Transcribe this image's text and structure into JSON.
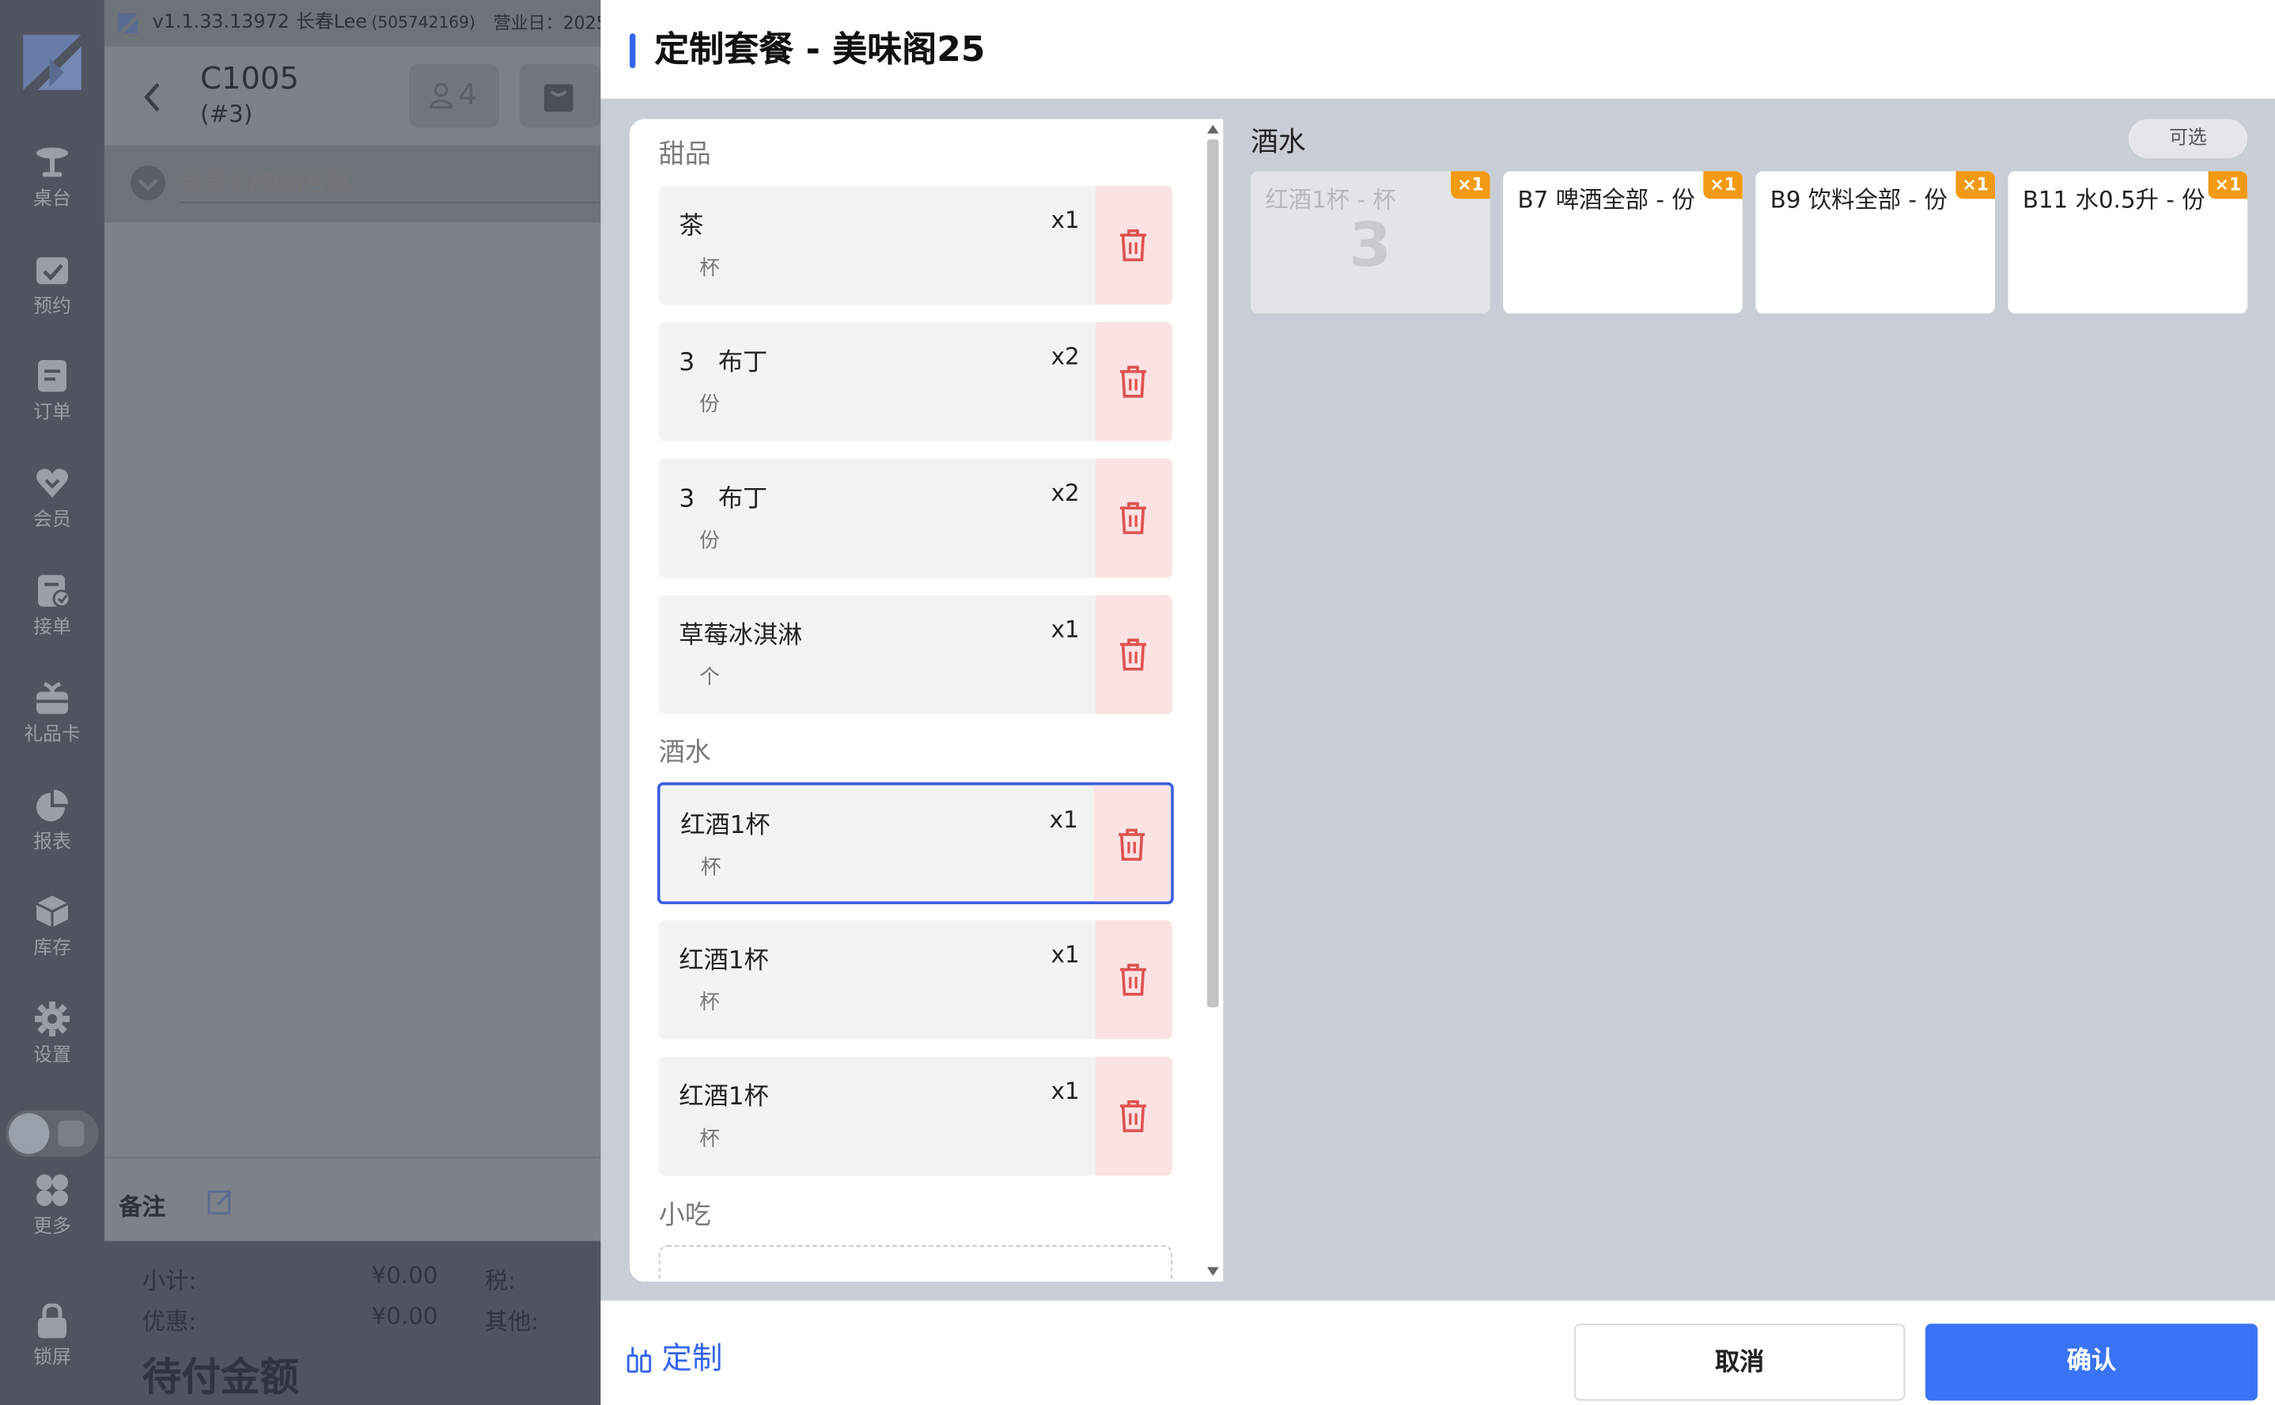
{
  "topbar": {
    "version": "v1.1.33.13972",
    "user": "长春Lee",
    "user_id": "(505742169)",
    "business_day": "营业日：2025"
  },
  "order": {
    "table": "C1005",
    "sub": "(#3)",
    "guests": "4"
  },
  "member": {
    "placeholder": "会员卡/电话号码"
  },
  "sidebar": {
    "items": [
      {
        "label": "桌台",
        "icon": "table-icon"
      },
      {
        "label": "预约",
        "icon": "calendar-check-icon"
      },
      {
        "label": "订单",
        "icon": "order-icon"
      },
      {
        "label": "会员",
        "icon": "heart-icon"
      },
      {
        "label": "接单",
        "icon": "accept-order-icon"
      },
      {
        "label": "礼品卡",
        "icon": "gift-card-icon"
      },
      {
        "label": "报表",
        "icon": "pie-chart-icon"
      },
      {
        "label": "库存",
        "icon": "box-icon"
      },
      {
        "label": "设置",
        "icon": "gear-icon"
      },
      {
        "label": "更多",
        "icon": "grid-icon"
      },
      {
        "label": "锁屏",
        "icon": "lock-icon"
      }
    ]
  },
  "notes": {
    "label": "备注"
  },
  "totals": {
    "subtotal_label": "小计:",
    "subtotal": "¥0.00",
    "tax_label": "税:",
    "discount_label": "优惠:",
    "discount": "¥0.00",
    "other_label": "其他:",
    "due_label": "待付金额"
  },
  "modal": {
    "title": "定制套餐 - 美味阁25",
    "sections": [
      {
        "name": "甜品",
        "items": [
          {
            "name": "茶",
            "unit": "杯",
            "qty": "x1",
            "selected": false
          },
          {
            "name": "3   布丁",
            "unit": "份",
            "qty": "x2",
            "selected": false
          },
          {
            "name": "3   布丁",
            "unit": "份",
            "qty": "x2",
            "selected": false
          },
          {
            "name": "草莓冰淇淋",
            "unit": "个",
            "qty": "x1",
            "selected": false
          }
        ]
      },
      {
        "name": "酒水",
        "items": [
          {
            "name": "红酒1杯",
            "unit": "杯",
            "qty": "x1",
            "selected": true
          },
          {
            "name": "红酒1杯",
            "unit": "杯",
            "qty": "x1",
            "selected": false
          },
          {
            "name": "红酒1杯",
            "unit": "杯",
            "qty": "x1",
            "selected": false
          }
        ]
      },
      {
        "name": "小吃",
        "items": []
      }
    ],
    "options_title": "酒水",
    "optional_label": "可选",
    "options": [
      {
        "name": "红酒1杯 - 杯",
        "badge": "×1",
        "count": "3",
        "disabled": true
      },
      {
        "name": "B7 啤酒全部 - 份",
        "badge": "×1",
        "count": "",
        "disabled": false
      },
      {
        "name": "B9 饮料全部 - 份",
        "badge": "×1",
        "count": "",
        "disabled": false
      },
      {
        "name": "B11 水0.5升 - 份",
        "badge": "×1",
        "count": "",
        "disabled": false
      }
    ],
    "custom_label": "定制",
    "cancel_label": "取消",
    "confirm_label": "确认"
  },
  "colors": {
    "accent": "#3a73f5",
    "badge": "#f39a14",
    "delete_bg": "#fbe3e3",
    "delete_icon": "#e05252"
  }
}
